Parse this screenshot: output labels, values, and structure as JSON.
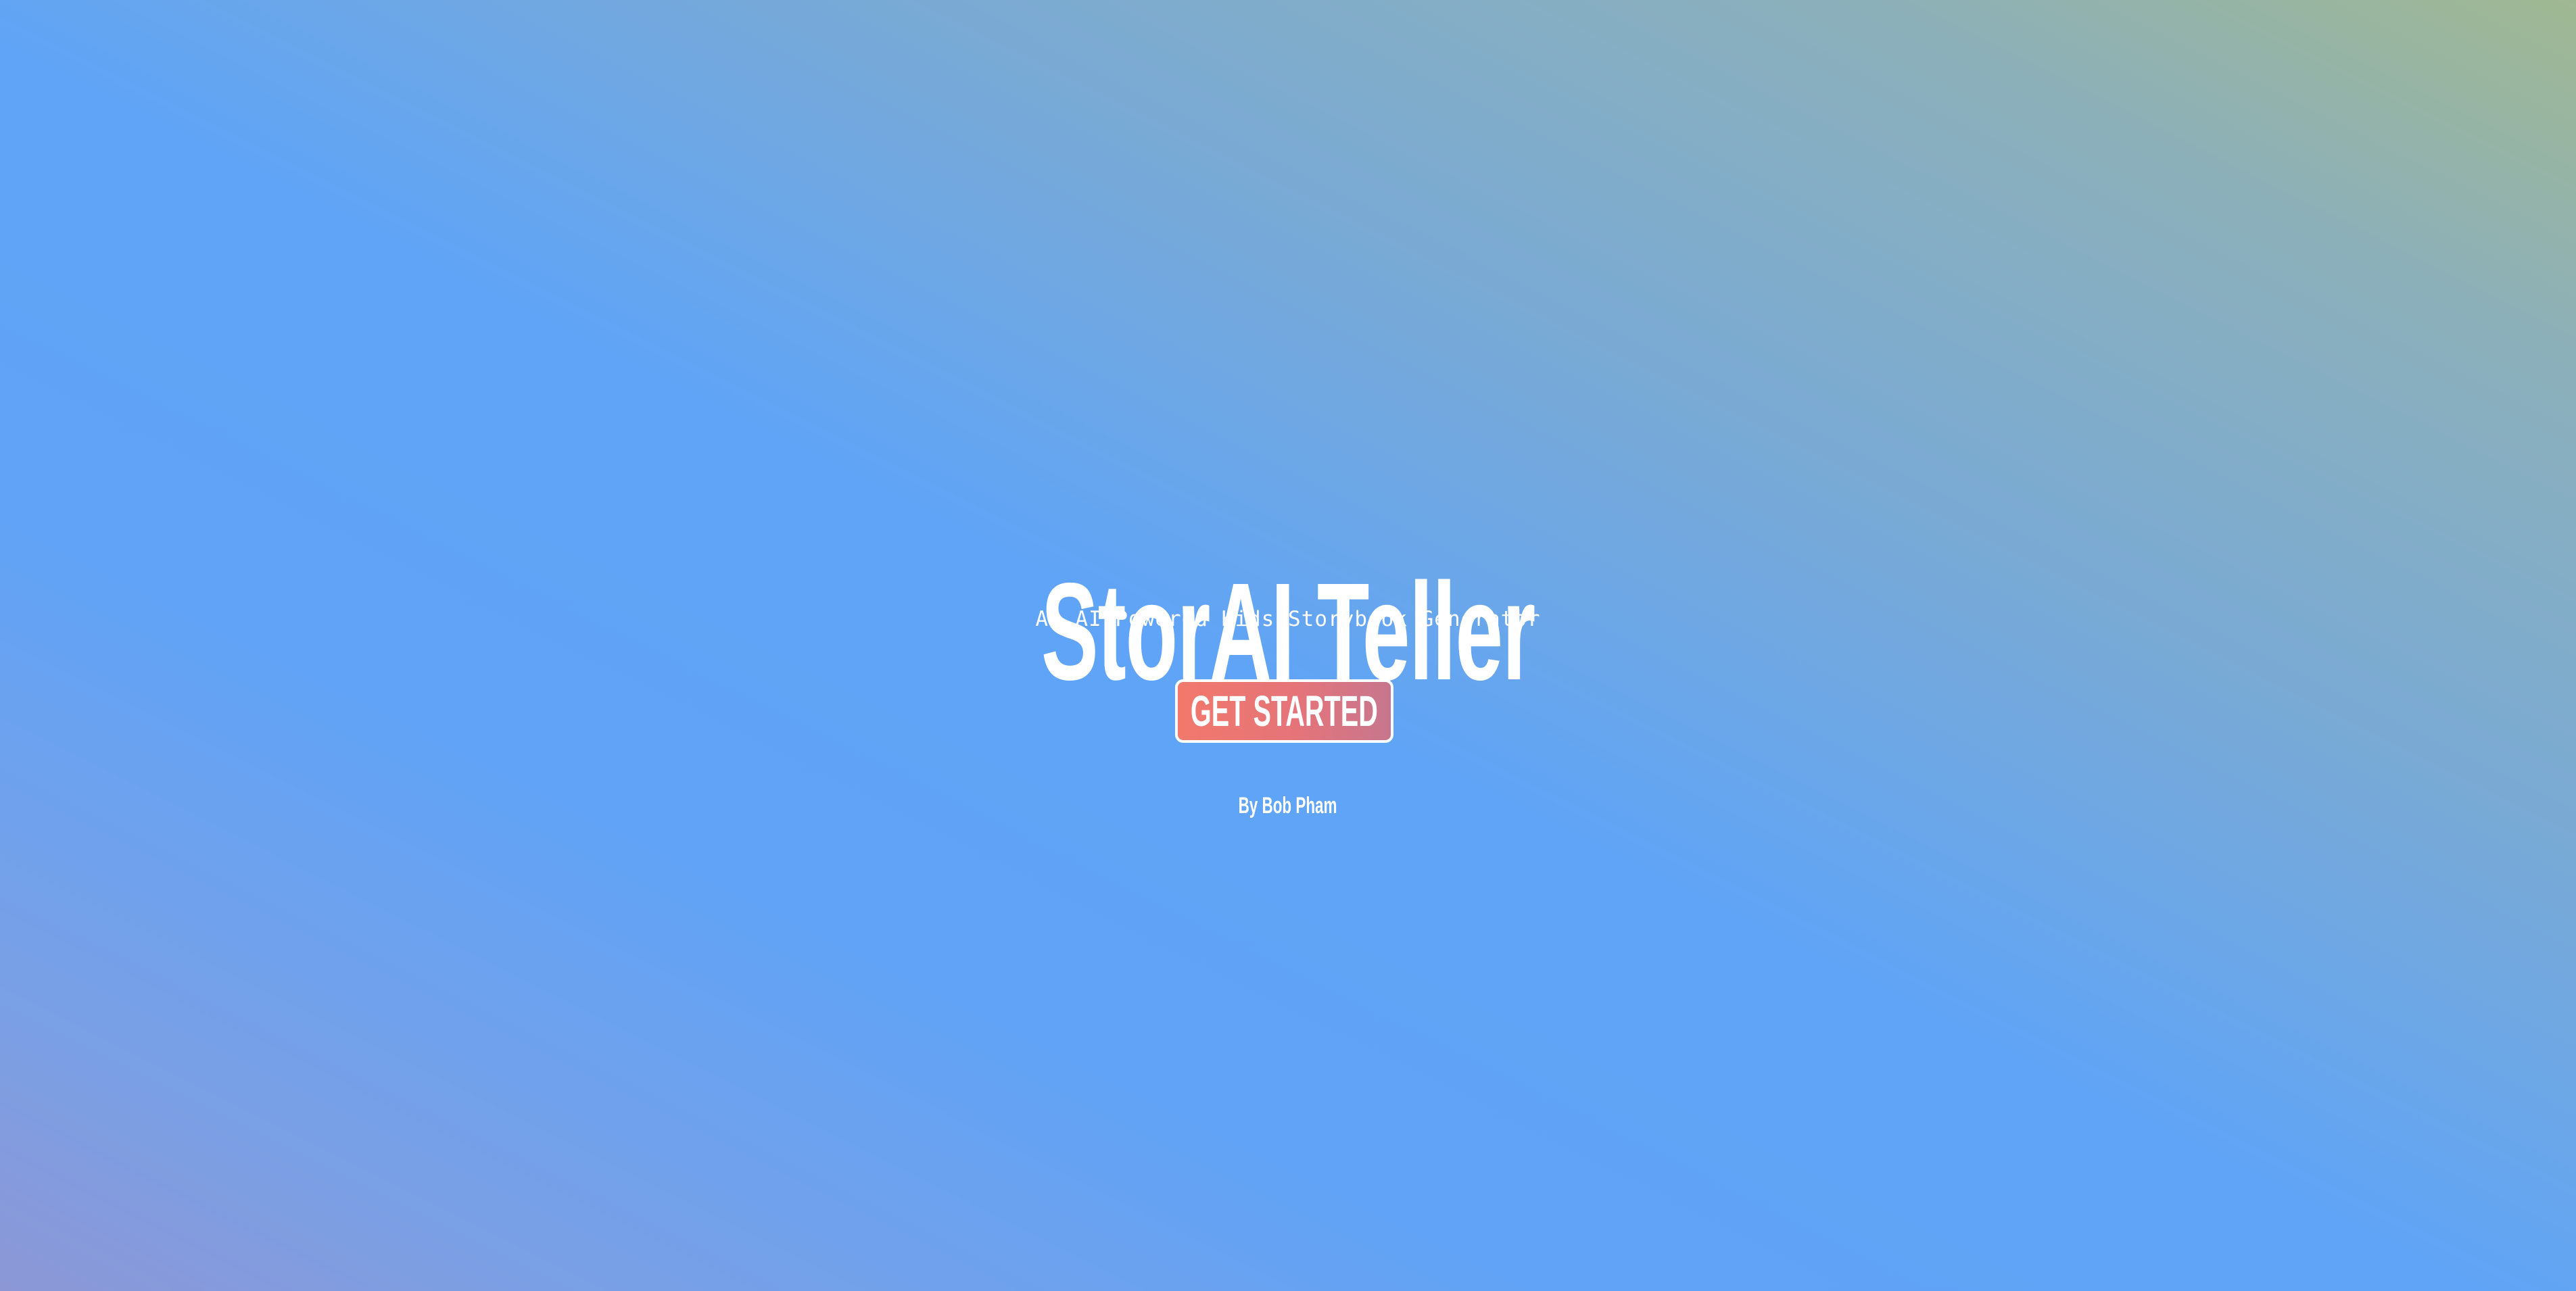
{
  "hero": {
    "title": "StorAI Teller",
    "subtitle": "An AI Powered Kids Storybook Generator",
    "cta_label": "GET STARTED",
    "byline": "By Bob Pham"
  },
  "colors": {
    "gradient_bottom_left": "#8c97d6",
    "gradient_middle": "#60a4f7",
    "gradient_top_right": "#a0b892",
    "cta_left": "#f2786c",
    "cta_right": "#c7768f",
    "text": "#ffffff"
  }
}
